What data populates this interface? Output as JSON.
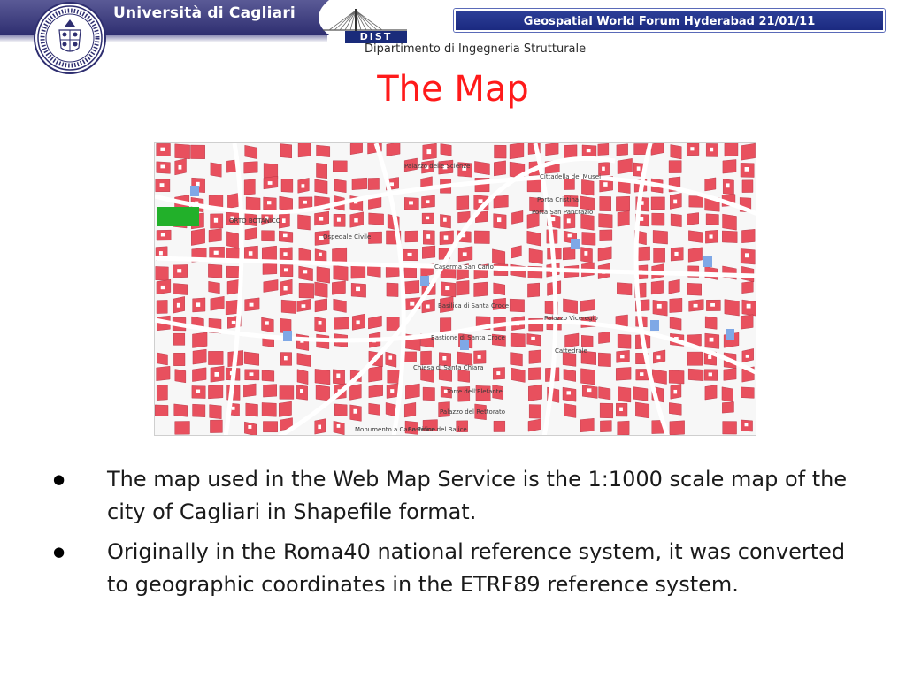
{
  "header": {
    "university": "Università di Cagliari",
    "dist_label": "DIST",
    "department": "Dipartimento di Ingegneria Strutturale",
    "forum": "Geospatial World Forum Hyderabad 21/01/11"
  },
  "slide": {
    "title": "The Map"
  },
  "map": {
    "labels": [
      "Palazzo delle Scienze",
      "Cittadella dei Musei",
      "Porta Cristina",
      "Porta San Pancrazio",
      "ORTO BOTANICO",
      "Ospedale Civile",
      "Caserma San Carlo",
      "Basilica di Santa Croce",
      "Palazzo Viceregio",
      "Bastione di Santa Croce",
      "Cattedrale",
      "Chiesa di Santa Chiara",
      "Torre dell'Elefante",
      "Palazzo del Rettorato",
      "Monumento a Carlo Felice",
      "Bastione del Balice"
    ],
    "colors": {
      "building": "#e8505e",
      "courtyard": "#ffffff",
      "water": "#7fa8e6",
      "park": "#22b02a"
    }
  },
  "bullets": [
    "The map used in the Web Map Service is the 1:1000 scale map of the city of Cagliari in Shapefile format.",
    "Originally in the Roma40 national reference system, it was converted to geographic coordinates in  the ETRF89 reference system."
  ],
  "icons": {
    "seal": "university-seal-icon",
    "dist": "dist-bridge-logo-icon",
    "bullet": "bullet-dot-icon"
  }
}
